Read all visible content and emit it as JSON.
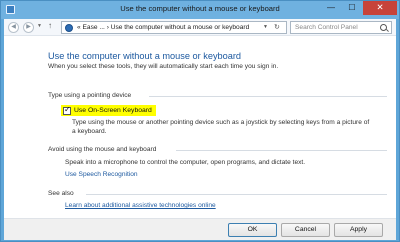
{
  "window": {
    "title": "Use the computer without a mouse or keyboard",
    "controls": {
      "minimize": "—",
      "maximize": "☐",
      "close": "✕"
    }
  },
  "navigation": {
    "back_icon": "back-arrow-icon",
    "forward_icon": "forward-arrow-icon",
    "up_icon": "up-arrow-icon",
    "address_text": "« Ease ... › Use the computer without a mouse or keyboard",
    "search_placeholder": "Search Control Panel"
  },
  "page": {
    "title": "Use the computer without a mouse or keyboard",
    "intro": "When you select these tools, they will automatically start each time you sign in."
  },
  "sections": {
    "pointing": {
      "heading": "Type using a pointing device",
      "checkbox_label": "Use On-Screen Keyboard",
      "checkbox_checked": true,
      "description": "Type using the mouse or another pointing device such as a joystick by selecting keys from a picture of a keyboard."
    },
    "avoid": {
      "heading": "Avoid using the mouse and keyboard",
      "text": "Speak into a microphone to control the computer, open programs, and dictate text.",
      "link": "Use Speech Recognition"
    },
    "see_also": {
      "heading": "See also",
      "link": "Learn about additional assistive technologies online"
    }
  },
  "buttons": {
    "ok": "OK",
    "cancel": "Cancel",
    "apply": "Apply"
  },
  "colors": {
    "titlebar": "#6fb1e0",
    "accent_link": "#1e5aa0",
    "highlight": "#ffff00"
  }
}
